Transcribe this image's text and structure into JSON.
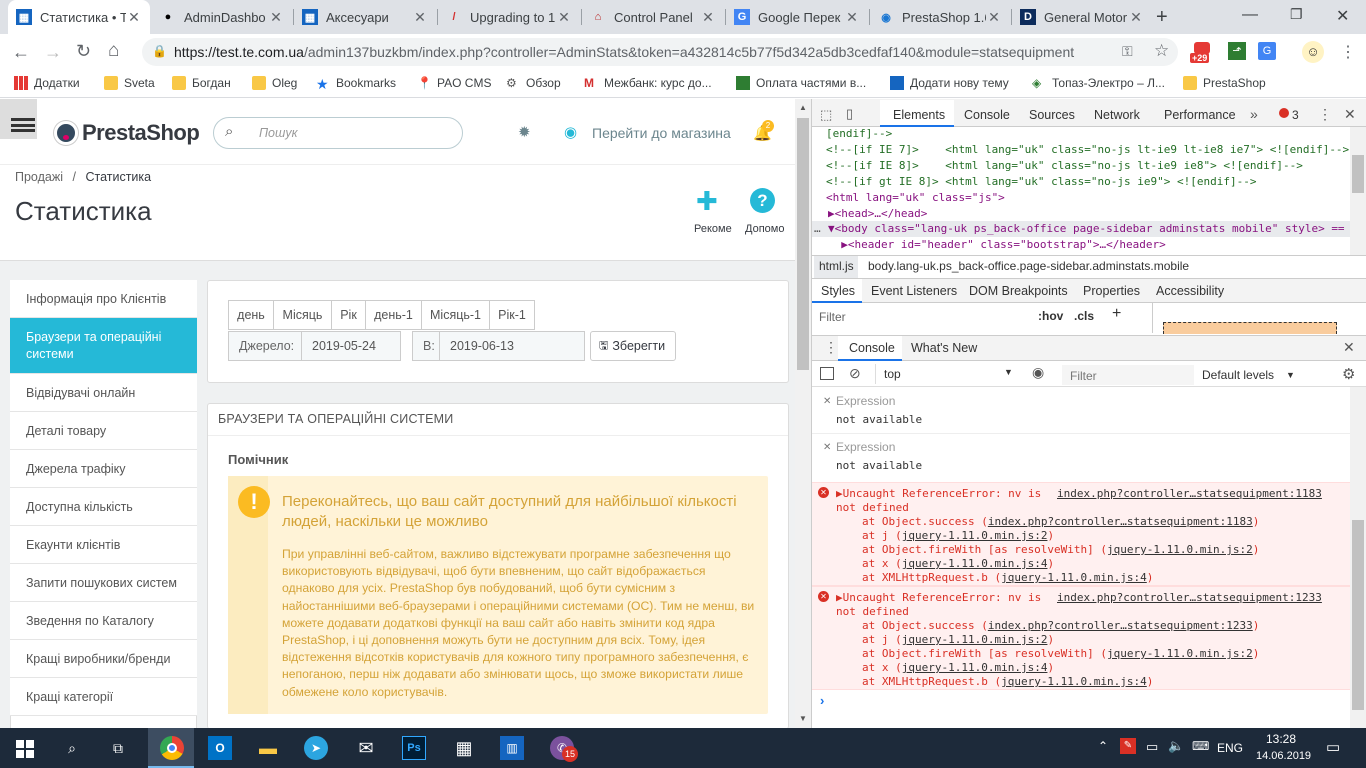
{
  "browser": {
    "tabs": [
      {
        "title": "Статистика • Т",
        "active": true
      },
      {
        "title": "AdminDashbo"
      },
      {
        "title": "Аксесуари"
      },
      {
        "title": "Upgrading to 1"
      },
      {
        "title": "Control Panel"
      },
      {
        "title": "Google Перек"
      },
      {
        "title": "PrestaShop 1.6"
      },
      {
        "title": "General Motor"
      }
    ],
    "url_host": "https://test.te.com.ua",
    "url_path": "/admin137buzkbm/index.php?controller=AdminStats&token=a432814c5b77f5d342a5db3cedfaf140&module=statsequipment",
    "ext_badge": "+29",
    "bookmarks": [
      "Додатки",
      "Sveta",
      "Богдан",
      "Oleg",
      "Bookmarks",
      "PAO CMS",
      "Обзор",
      "Межбанк: курс до...",
      "Оплата частями в...",
      "Додати нову тему",
      "Топаз-Электро – Л...",
      "PrestaShop"
    ]
  },
  "ps": {
    "logo": "PrestaShop",
    "search_placeholder": "Пошук",
    "view_shop": "Перейти до магазина",
    "notif_count": "2",
    "breadcrumb_parent": "Продажі",
    "breadcrumb_sep": "/",
    "breadcrumb_current": "Статистика",
    "page_title": "Статистика",
    "toolbar_btn1": "Рекоме",
    "toolbar_btn2": "Допомо",
    "sidebar": [
      "Інформація про Клієнтів",
      "Браузери та операційні системи",
      "Відвідувачі онлайн",
      "Деталі товару",
      "Джерела трафіку",
      "Доступна кількість",
      "Екаунти клієнтів",
      "Запити пошукових систем",
      "Зведення по Каталогу",
      "Кращі виробники/бренди",
      "Кращі категорії"
    ],
    "date_buttons": [
      "день",
      "Місяць",
      "Рік",
      "день-1",
      "Місяць-1",
      "Рік-1"
    ],
    "from_label": "Джерело:",
    "from_value": "2019-05-24",
    "to_label": "В:",
    "to_value": "2019-06-13",
    "save_label": "Зберегти",
    "section_title": "БРАУЗЕРИ ТА ОПЕРАЦІЙНІ СИСТЕМИ",
    "helper_title": "Помічник",
    "alert_title": "Переконайтесь, що ваш сайт доступний для найбільшої кількості людей, наскільки це можливо",
    "alert_body": "При управлінні веб-сайтом, важливо відстежувати програмне забезпечення що використовують відвідувачі, щоб бути впевненим, що сайт відображається однаково для усіх. PrestaShop був побудований, щоб бути сумісним з найостаннішими веб-браузерами і операційними системами (ОС). Тим не менш, ви можете додавати додаткові функції на ваш сайт або навіть змінити код ядра PrestaShop, і ці доповнення можуть бути не доступним для всіх. Тому, ідея відстеження відсотків користувачів для кожного типу програмного забезпечення, є непоганою, перш ніж додавати або змінювати щось, що зможе використати лише обмежене коло користувачів."
  },
  "devtools": {
    "tabs": [
      "Elements",
      "Console",
      "Sources",
      "Network",
      "Performance"
    ],
    "error_count": "3",
    "html_lines": [
      "[endif]-->",
      "<!--[if IE 7]>    <html lang=\"uk\" class=\"no-js lt-ie9 lt-ie8 ie7\"> <![endif]-->",
      "<!--[if IE 8]>    <html lang=\"uk\" class=\"no-js lt-ie9 ie8\"> <![endif]-->",
      "<!--[if gt IE 8]> <html lang=\"uk\" class=\"no-js ie9\"> <![endif]-->",
      "<html lang=\"uk\" class=\"js\">",
      "▶<head>…</head>",
      "▼<body class=\"lang-uk ps_back-office page-sidebar adminstats mobile\" style> ==",
      "  ▶<header id=\"header\" class=\"bootstrap\">…</header>"
    ],
    "crumb1": "html.js",
    "crumb2": "body.lang-uk.ps_back-office.page-sidebar.adminstats.mobile",
    "style_tabs": [
      "Styles",
      "Event Listeners",
      "DOM Breakpoints",
      "Properties",
      "Accessibility"
    ],
    "filter_placeholder": "Filter",
    "hov": ":hov",
    "cls": ".cls",
    "drawer_tabs": [
      "Console",
      "What's New"
    ],
    "context": "top",
    "levels": "Default levels",
    "expr_label": "Expression",
    "expr_value": "not available",
    "errors": [
      {
        "msg": "▶Uncaught ReferenceError: nv is",
        "msg2": "not defined",
        "src": "index.php?controller…statsequipment:1183",
        "stack": [
          [
            "at Object.success (",
            "index.php?controller…statsequipment:1183",
            ")"
          ],
          [
            "at j (",
            "jquery-1.11.0.min.js:2",
            ")"
          ],
          [
            "at Object.fireWith [as resolveWith] (",
            "jquery-1.11.0.min.js:2",
            ")"
          ],
          [
            "at x (",
            "jquery-1.11.0.min.js:4",
            ")"
          ],
          [
            "at XMLHttpRequest.b (",
            "jquery-1.11.0.min.js:4",
            ")"
          ]
        ]
      },
      {
        "msg": "▶Uncaught ReferenceError: nv is",
        "msg2": "not defined",
        "src": "index.php?controller…statsequipment:1233",
        "stack": [
          [
            "at Object.success (",
            "index.php?controller…statsequipment:1233",
            ")"
          ],
          [
            "at j (",
            "jquery-1.11.0.min.js:2",
            ")"
          ],
          [
            "at Object.fireWith [as resolveWith] (",
            "jquery-1.11.0.min.js:2",
            ")"
          ],
          [
            "at x (",
            "jquery-1.11.0.min.js:4",
            ")"
          ],
          [
            "at XMLHttpRequest.b (",
            "jquery-1.11.0.min.js:4",
            ")"
          ]
        ]
      }
    ]
  },
  "taskbar": {
    "lang": "ENG",
    "time": "13:28",
    "date": "14.06.2019",
    "viber_badge": "15"
  }
}
